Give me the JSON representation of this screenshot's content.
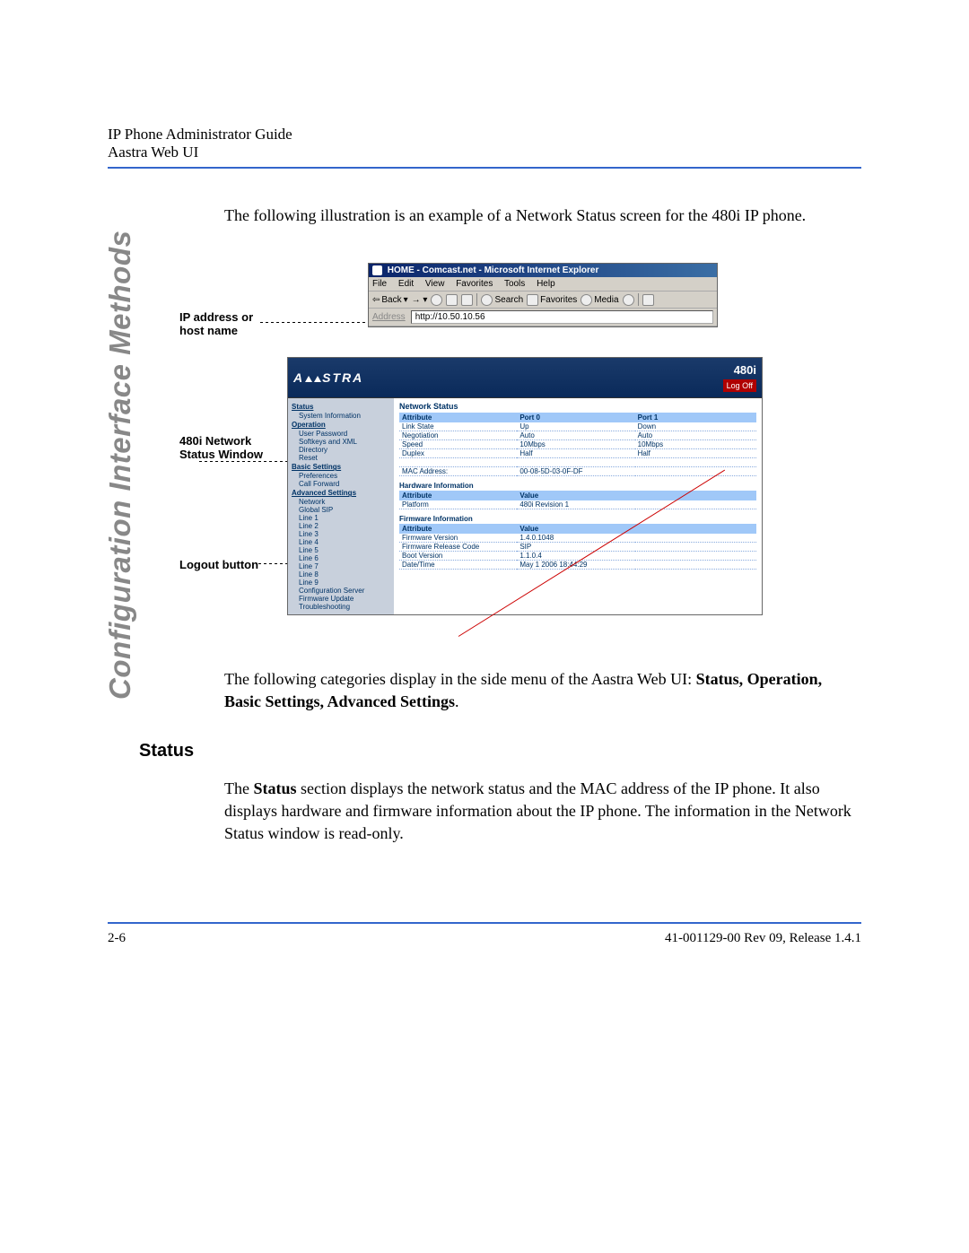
{
  "header": {
    "line1": "IP Phone Administrator Guide",
    "line2": "Aastra Web UI"
  },
  "side_title": "Configuration Interface Methods",
  "intro": "The following illustration is an example of a Network Status screen for the 480i IP phone.",
  "callouts": {
    "addr": "IP address or host name",
    "window": "480i Network Status Window",
    "logout": "Logout button"
  },
  "browser": {
    "title": "HOME - Comcast.net - Microsoft Internet Explorer",
    "menu": [
      "File",
      "Edit",
      "View",
      "Favorites",
      "Tools",
      "Help"
    ],
    "toolbar": {
      "back": "Back",
      "search": "Search",
      "favorites": "Favorites",
      "media": "Media"
    },
    "addr_label": "Address",
    "url": "http://10.50.10.56"
  },
  "aastra": {
    "logo": "A   STRA",
    "model": "480i",
    "logoff": "Log Off",
    "sidebar": {
      "status": {
        "head": "Status",
        "items": [
          "System Information"
        ]
      },
      "operation": {
        "head": "Operation",
        "items": [
          "User Password",
          "Softkeys and XML",
          "Directory",
          "Reset"
        ]
      },
      "basic": {
        "head": "Basic Settings",
        "items": [
          "Preferences",
          "Call Forward"
        ]
      },
      "advanced": {
        "head": "Advanced Settings",
        "items": [
          "Network",
          "Global SIP",
          "Line 1",
          "Line 2",
          "Line 3",
          "Line 4",
          "Line 5",
          "Line 6",
          "Line 7",
          "Line 8",
          "Line 9",
          "Configuration Server",
          "Firmware Update",
          "Troubleshooting"
        ]
      }
    },
    "content": {
      "title": "Network Status",
      "net": {
        "h_attr": "Attribute",
        "h_p0": "Port 0",
        "h_p1": "Port 1",
        "rows": [
          {
            "a": "Link State",
            "p0": "Up",
            "p1": "Down"
          },
          {
            "a": "Negotiation",
            "p0": "Auto",
            "p1": "Auto"
          },
          {
            "a": "Speed",
            "p0": "10Mbps",
            "p1": "10Mbps"
          },
          {
            "a": "Duplex",
            "p0": "Half",
            "p1": "Half"
          }
        ],
        "mac_label": "MAC Address:",
        "mac": "00-08-5D-03-0F-DF"
      },
      "hw": {
        "title": "Hardware Information",
        "h_attr": "Attribute",
        "h_val": "Value",
        "rows": [
          {
            "a": "Platform",
            "v": "480i Revision 1"
          }
        ]
      },
      "fw": {
        "title": "Firmware Information",
        "h_attr": "Attribute",
        "h_val": "Value",
        "rows": [
          {
            "a": "Firmware Version",
            "v": "1.4.0.1048"
          },
          {
            "a": "Firmware Release Code",
            "v": "SIP"
          },
          {
            "a": "Boot Version",
            "v": "1.1.0.4"
          },
          {
            "a": "Date/Time",
            "v": "May 1 2006 18:44:29"
          }
        ]
      }
    }
  },
  "outro_prefix": "The following categories display in the side menu of the Aastra Web UI: ",
  "outro_bold": "Status, Operation, Basic Settings, Advanced Settings",
  "outro_suffix": ".",
  "section_heading": "Status",
  "status_p_pre": "The ",
  "status_p_bold": "Status",
  "status_p_post": " section displays the network status and the MAC address of the IP phone. It also displays hardware and firmware information about the IP phone. The information in the Network Status window is read-only.",
  "footer": {
    "left": "2-6",
    "right": "41-001129-00 Rev 09, Release 1.4.1"
  }
}
